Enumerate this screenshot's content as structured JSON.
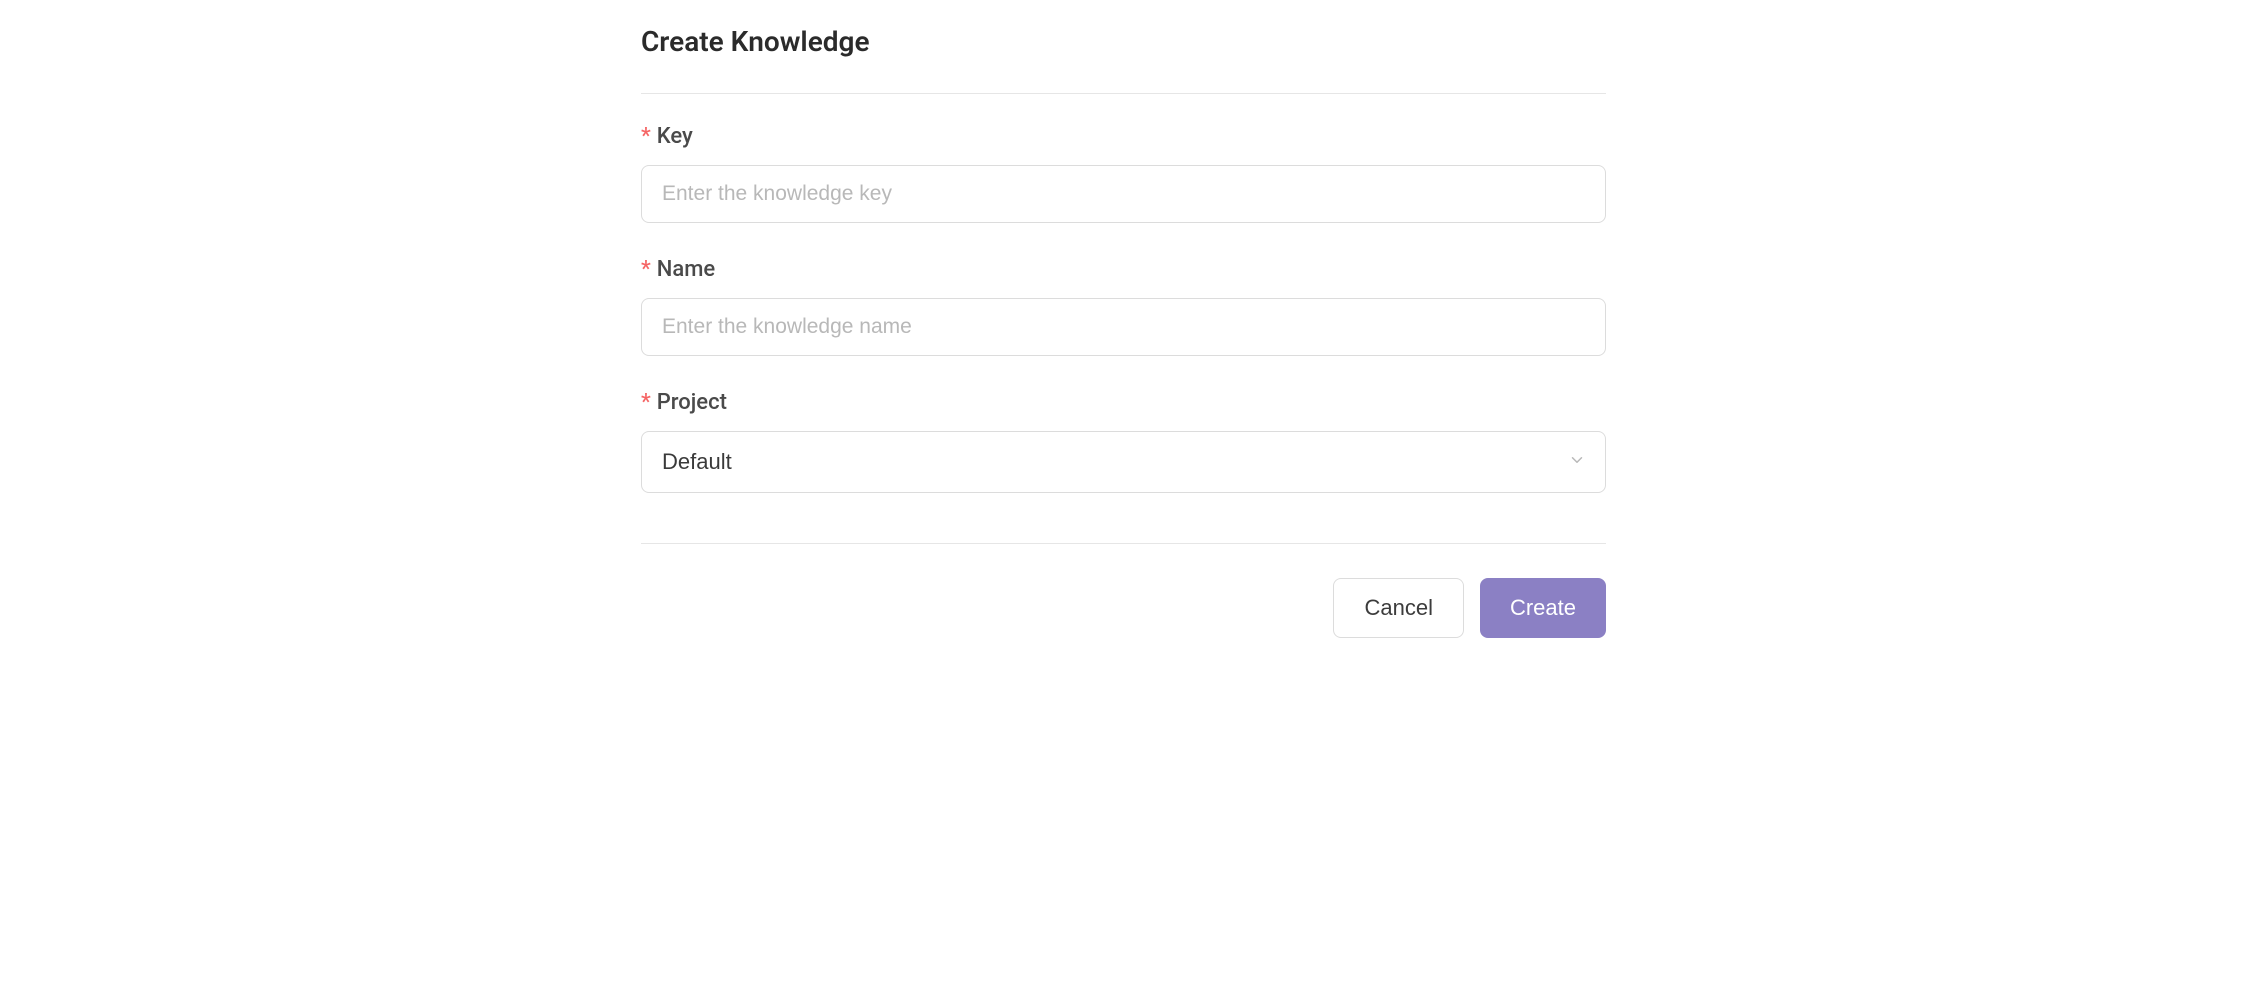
{
  "header": {
    "title": "Create Knowledge"
  },
  "form": {
    "required_mark": "*",
    "fields": {
      "key": {
        "label": "Key",
        "placeholder": "Enter the knowledge key",
        "value": ""
      },
      "name": {
        "label": "Name",
        "placeholder": "Enter the knowledge name",
        "value": ""
      },
      "project": {
        "label": "Project",
        "selected": "Default"
      }
    }
  },
  "footer": {
    "cancel_label": "Cancel",
    "create_label": "Create"
  }
}
